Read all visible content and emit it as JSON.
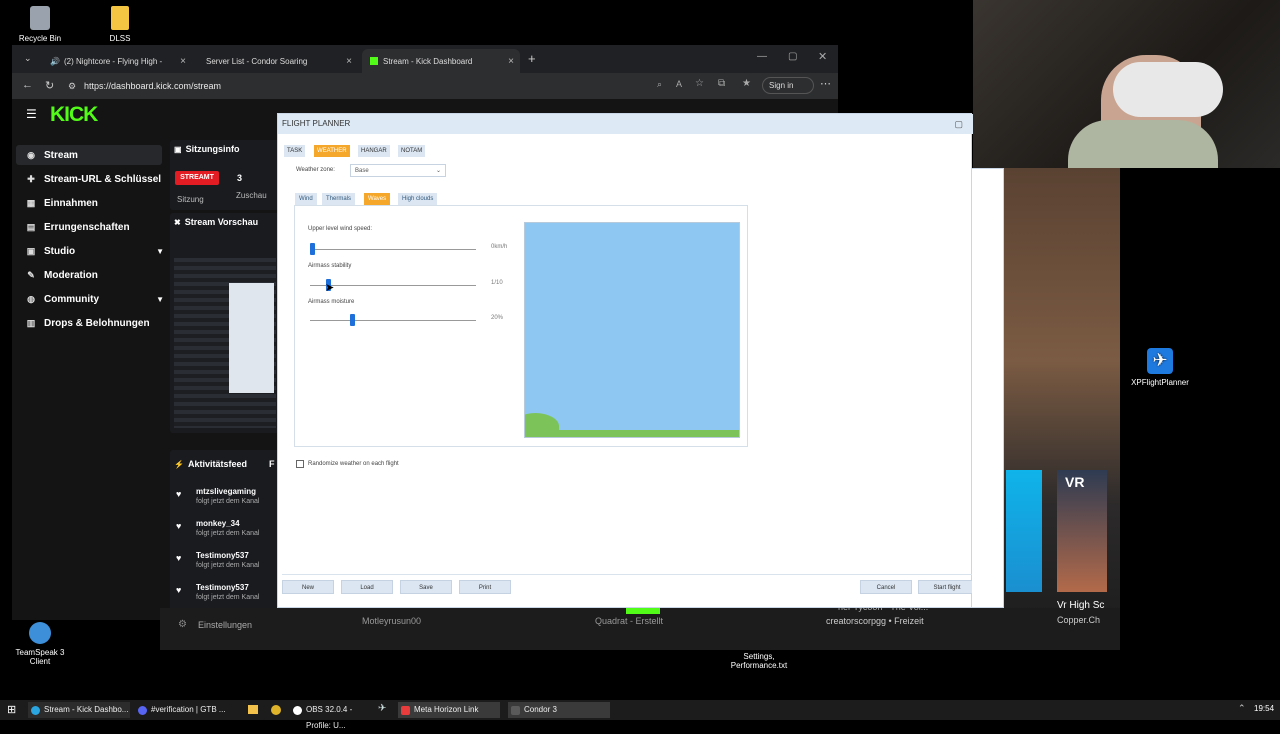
{
  "desktop": {
    "recycle_bin": "Recycle Bin",
    "dlss": "DLSS",
    "xpflightplanner": "XPFlightPlanner",
    "teamspeak": "TeamSpeak 3 Client",
    "settings_file": "Settings, Performance.txt"
  },
  "browser": {
    "tabs": [
      {
        "label": "(2) Nightcore - Flying High -"
      },
      {
        "label": "Server List - Condor Soaring"
      },
      {
        "label": "Stream - Kick Dashboard"
      }
    ],
    "url": "https://dashboard.kick.com/stream",
    "sign_in": "Sign in"
  },
  "kick": {
    "logo": "KICK",
    "nav": [
      {
        "label": "Stream"
      },
      {
        "label": "Stream-URL & Schlüssel"
      },
      {
        "label": "Einnahmen"
      },
      {
        "label": "Errungenschaften"
      },
      {
        "label": "Studio"
      },
      {
        "label": "Moderation"
      },
      {
        "label": "Community"
      },
      {
        "label": "Drops & Belohnungen"
      }
    ],
    "session_title": "Sitzungsinfo",
    "live_badge": "STREAMT",
    "viewers": "3",
    "session_label": "Sitzung",
    "viewers_label": "Zuschau",
    "preview_title": "Stream Vorschau",
    "activity_title": "Aktivitätsfeed",
    "activity_extra": "F",
    "activity": [
      {
        "user": "mtzslivegaming",
        "text": "folgt jetzt dem Kanal"
      },
      {
        "user": "monkey_34",
        "text": "folgt jetzt dem Kanal"
      },
      {
        "user": "Testimony537",
        "text": "folgt jetzt dem Kanal"
      },
      {
        "user": "Testimony537",
        "text": "folgt jetzt dem Kanal"
      }
    ],
    "settings_label": "Einstellungen",
    "bg_text1": "Motleyrusun00",
    "bg_text2": "Quadrat - Erstellt",
    "bg_text3": "creatorscorpgg • Freizeit",
    "bg_text4": "ner Tycoon - The Vol..."
  },
  "planner": {
    "title": "FLIGHT PLANNER",
    "tabs": [
      "TASK",
      "WEATHER",
      "HANGAR",
      "NOTAM"
    ],
    "weather_zone_label": "Weather zone:",
    "weather_zone_value": "Base",
    "subtabs": [
      "Wind",
      "Thermals",
      "Waves",
      "High clouds"
    ],
    "sliders": [
      {
        "label": "Upper level wind speed:",
        "value_text": "0km/h",
        "fraction": 0.0
      },
      {
        "label": "Airmass stability",
        "value_text": "1/10",
        "fraction": 0.1
      },
      {
        "label": "Airmass moisture",
        "value_text": "20%",
        "fraction": 0.25
      }
    ],
    "randomize_label": "Randomize weather on each flight",
    "buttons": [
      "New",
      "Load",
      "Save",
      "Print"
    ],
    "cancel": "Cancel",
    "start": "Start flight"
  },
  "streams": {
    "vr_label": "VR",
    "vr_title": "Vr High Sc",
    "vr_sub": "Copper.Ch"
  },
  "taskbar": {
    "items": [
      {
        "label": "Stream - Kick Dashbo..."
      },
      {
        "label": "#verification | GTB ..."
      },
      {
        "label": "OBS 32.0.4 - Profile: U..."
      },
      {
        "label": "Meta Horizon Link"
      },
      {
        "label": "Condor 3"
      }
    ],
    "clock": "19:54"
  },
  "colors": {
    "kick_green": "#53fc18",
    "planner_orange": "#f4a72a",
    "sky": "#8ec8f2",
    "ground": "#7cc45a",
    "live_red": "#e31b23"
  }
}
